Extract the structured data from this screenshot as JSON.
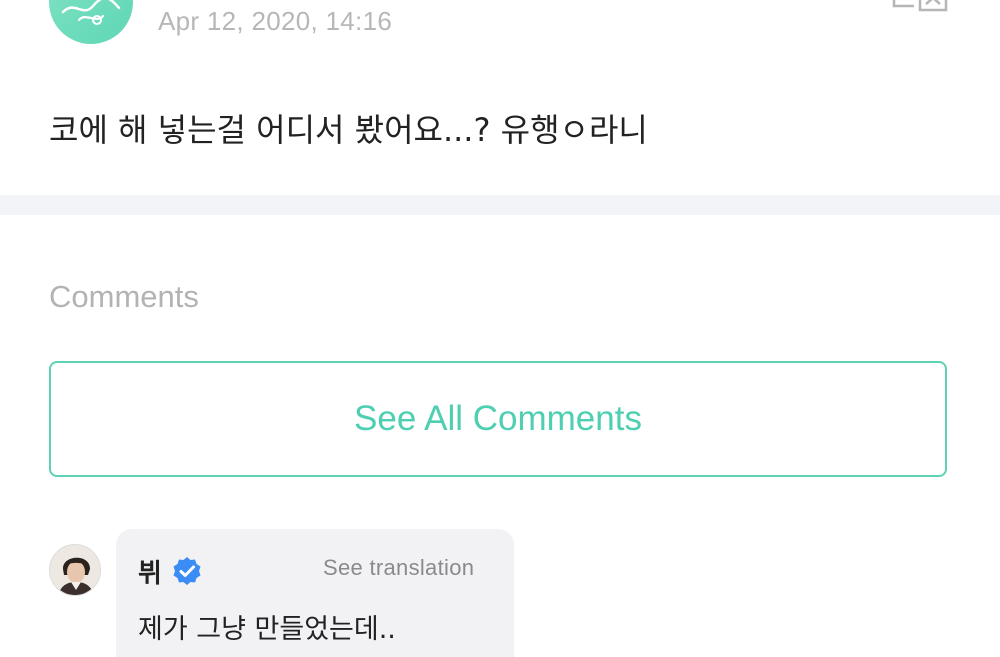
{
  "post": {
    "date": "Apr 12, 2020, 14:16",
    "text": "코에 해 넣는걸 어디서 봤어요...? 유행ㅇ라니"
  },
  "comments_section": {
    "heading": "Comments",
    "see_all_label": "See All Comments"
  },
  "comment": {
    "author": "뷔",
    "translate_label": "See translation",
    "text": "제가 그냥 만들었는데.."
  },
  "colors": {
    "accent": "#4fcfb2",
    "verified": "#3b8cf5",
    "bubble_bg": "#f2f2f5",
    "divider": "#f3f4f8"
  },
  "icons": {
    "translate": "translate-icon",
    "verified": "verified-badge-icon"
  }
}
